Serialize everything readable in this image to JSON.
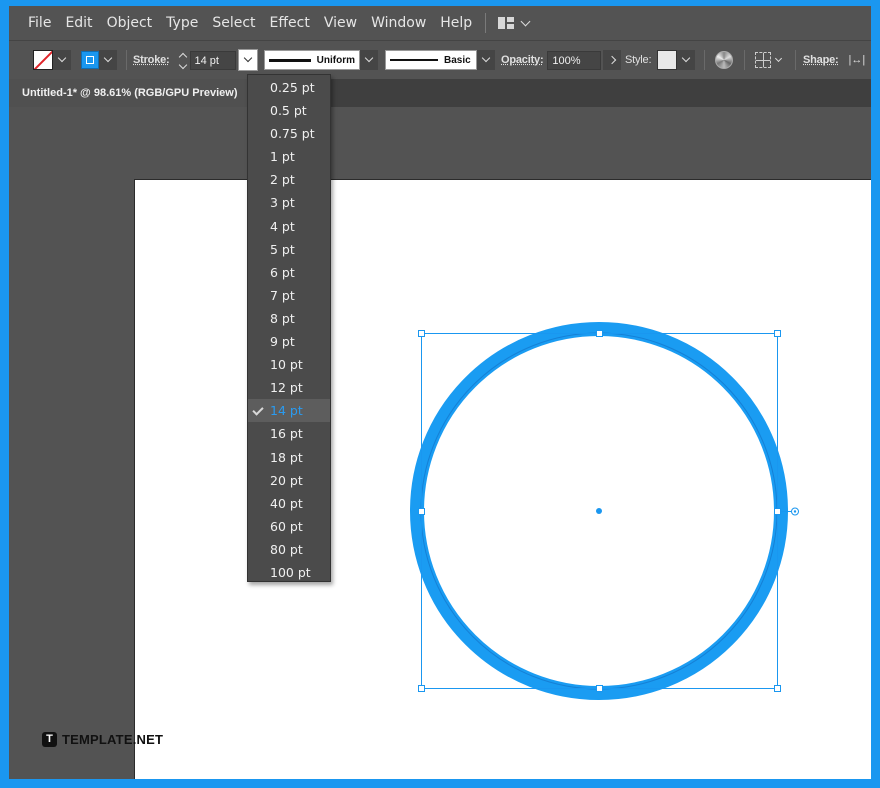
{
  "menu": [
    "File",
    "Edit",
    "Object",
    "Type",
    "Select",
    "Effect",
    "View",
    "Window",
    "Help"
  ],
  "control_bar": {
    "stroke_label": "Stroke:",
    "stroke_value": "14 pt",
    "variable_width_profile": "Uniform",
    "brush_definition": "Basic",
    "opacity_label": "Opacity:",
    "opacity_value": "100%",
    "style_label": "Style:",
    "shape_label": "Shape:"
  },
  "document_tab": {
    "title": "Untitled-1* @ 98.61% (RGB/GPU Preview)"
  },
  "stroke_weight_menu": {
    "options": [
      "0.25 pt",
      "0.5 pt",
      "0.75 pt",
      "1 pt",
      "2 pt",
      "3 pt",
      "4 pt",
      "5 pt",
      "6 pt",
      "7 pt",
      "8 pt",
      "9 pt",
      "10 pt",
      "12 pt",
      "14 pt",
      "16 pt",
      "18 pt",
      "20 pt",
      "40 pt",
      "60 pt",
      "80 pt",
      "100 pt"
    ],
    "selected": "14 pt"
  },
  "colors": {
    "selection": "#1a97f0",
    "stroke_color": "#1a9cf2",
    "fill": "none",
    "frame_border": "#1a97f0"
  },
  "watermark": {
    "logo_letter": "T",
    "text": "TEMPLATE.NET"
  }
}
